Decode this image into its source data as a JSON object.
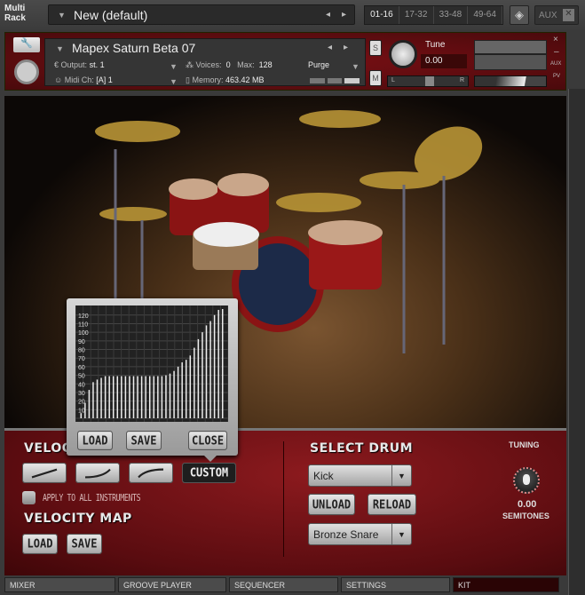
{
  "topbar": {
    "logo": "Multi Rack",
    "multi_name": "New (default)",
    "pages": [
      "01-16",
      "17-32",
      "33-48",
      "49-64"
    ],
    "active_page": "01-16",
    "aux_label": "AUX"
  },
  "instrument": {
    "name": "Mapex Saturn Beta 07",
    "output_label": "Output:",
    "output_value": "st. 1",
    "voices_label": "Voices:",
    "voices_value": "0",
    "max_label": "Max:",
    "max_value": "128",
    "purge_label": "Purge",
    "midi_label": "Midi Ch:",
    "midi_value": "[A]  1",
    "memory_label": "Memory:",
    "memory_value": "463.42 MB",
    "solo": "S",
    "mute": "M",
    "tune_label": "Tune",
    "tune_value": "0.00",
    "pan_l": "L",
    "pan_r": "R",
    "aux": "AUX",
    "pv": "PV",
    "close": "×",
    "minimize": "–"
  },
  "velocity": {
    "heading": "VELOCITY",
    "custom_label": "CUSTOM",
    "apply_all": "APPLY TO ALL INSTRUMENTS",
    "apply_all_checked": false,
    "map_heading": "VELOCITY MAP",
    "load": "LOAD",
    "save": "SAVE"
  },
  "popup": {
    "load": "LOAD",
    "save": "SAVE",
    "close": "CLOSE",
    "yticks": [
      "120",
      "110",
      "100",
      "90",
      "80",
      "70",
      "60",
      "50",
      "40",
      "30",
      "20",
      "10"
    ]
  },
  "chart_data": {
    "type": "bar",
    "title": "Custom velocity curve",
    "ylim": [
      0,
      127
    ],
    "values": [
      6,
      18,
      33,
      42,
      45,
      47,
      49,
      49,
      49,
      49,
      49,
      49,
      49,
      49,
      49,
      49,
      49,
      49,
      49,
      49,
      49,
      50,
      52,
      55,
      60,
      65,
      68,
      73,
      82,
      92,
      100,
      108,
      113,
      120,
      126,
      127
    ]
  },
  "drum": {
    "heading": "SELECT DRUM",
    "selected": "Kick",
    "unload": "UNLOAD",
    "reload": "RELOAD",
    "sample": "Bronze Snare",
    "tuning_label": "TUNING",
    "tuning_value": "0.00",
    "tuning_unit": "SEMITONES"
  },
  "tabs": [
    "MIXER",
    "GROOVE PLAYER",
    "SEQUENCER",
    "SETTINGS",
    "KIT"
  ],
  "active_tab": "KIT"
}
